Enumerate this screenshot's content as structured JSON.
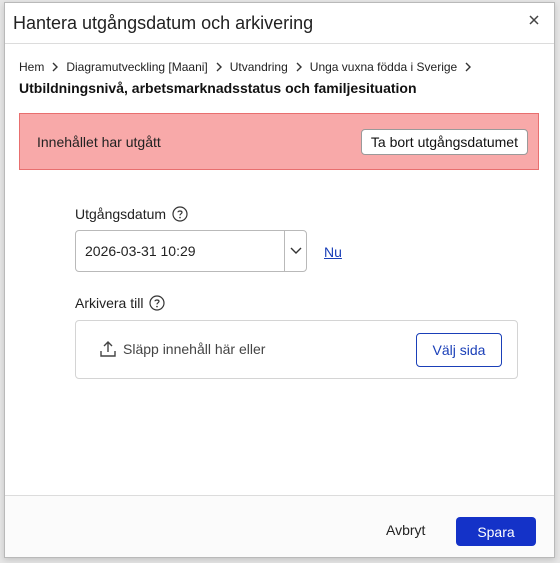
{
  "dialog": {
    "title": "Hantera utgångsdatum och arkivering",
    "close_icon": "close-icon"
  },
  "breadcrumb": {
    "items": [
      "Hem",
      "Diagramutveckling [Maani]",
      "Utvandring",
      "Unga vuxna födda i Sverige"
    ],
    "separator_icon": "chevron-right-icon",
    "current": "Utbildningsnivå, arbetsmarknadsstatus och familjesituation"
  },
  "alert": {
    "text": "Innehållet har utgått",
    "button_label": "Ta bort utgångsdatumet",
    "background": "#f8a9a9",
    "border": "#e86f6f"
  },
  "expiry": {
    "label": "Utgångsdatum",
    "help_icon": "help-circle-icon",
    "value": "2026-03-31 10:29",
    "dropdown_icon": "chevron-down-icon",
    "now_link": "Nu"
  },
  "archive": {
    "label": "Arkivera till",
    "help_icon": "help-circle-icon",
    "upload_icon": "upload-icon",
    "drop_text": "Släpp innehåll här eller",
    "pick_button": "Välj sida"
  },
  "footer": {
    "cancel_label": "Avbryt",
    "save_label": "Spara"
  },
  "colors": {
    "primary": "#1432c8",
    "link": "#1a3fb8"
  }
}
